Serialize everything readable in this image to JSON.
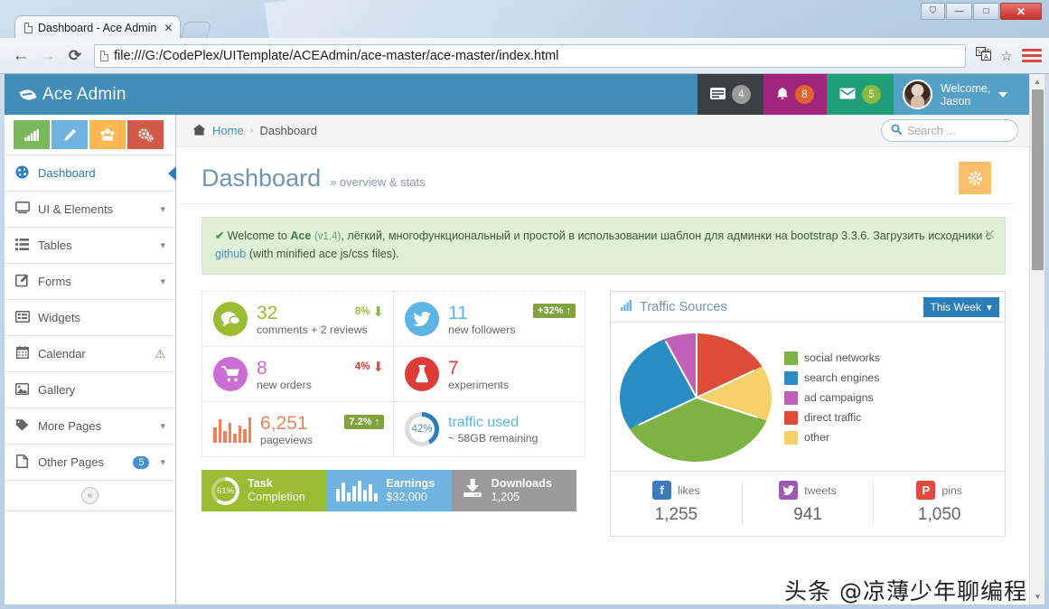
{
  "browser": {
    "tab_title": "Dashboard - Ace Admin",
    "tab_close": "✕",
    "url": "file:///G:/CodePlex/UITemplate/ACEAdmin/ace-master/ace-master/index.html",
    "back_icon": "←",
    "forward_icon": "→",
    "reload_icon": "⟳",
    "translate_icon": "translate-icon",
    "star_icon": "☆",
    "menu_icon": "hamburger-menu-icon",
    "win_user": "⛉",
    "win_minimize": "—",
    "win_maximize": "□",
    "win_close": "✕"
  },
  "navbar": {
    "brand": "Ace Admin",
    "tasks": {
      "icon": "tasks-icon",
      "count": "4"
    },
    "notifications": {
      "icon": "bell-icon",
      "count": "8"
    },
    "messages": {
      "icon": "envelope-icon",
      "count": "5"
    },
    "user": {
      "greeting": "Welcome,",
      "name": "Jason",
      "caret": "caret-down-icon"
    }
  },
  "sidebar": {
    "shortcuts": [
      {
        "name": "signal-icon",
        "glyph": "ᵚıı"
      },
      {
        "name": "pencil-icon",
        "glyph": "✎"
      },
      {
        "name": "users-icon",
        "glyph": "♟"
      },
      {
        "name": "cogs-icon",
        "glyph": "⚙"
      }
    ],
    "items": [
      {
        "label": "Dashboard",
        "icon": "dashboard-icon",
        "active": true,
        "chevron": false
      },
      {
        "label": "UI & Elements",
        "icon": "desktop-icon",
        "active": false,
        "chevron": true
      },
      {
        "label": "Tables",
        "icon": "list-icon",
        "active": false,
        "chevron": true
      },
      {
        "label": "Forms",
        "icon": "edit-icon",
        "active": false,
        "chevron": true
      },
      {
        "label": "Widgets",
        "icon": "widgets-icon",
        "active": false,
        "chevron": false
      },
      {
        "label": "Calendar",
        "icon": "calendar-icon",
        "active": false,
        "chevron": false,
        "warning": "⚠"
      },
      {
        "label": "Gallery",
        "icon": "image-icon",
        "active": false,
        "chevron": false
      },
      {
        "label": "More Pages",
        "icon": "tag-icon",
        "active": false,
        "chevron": true
      },
      {
        "label": "Other Pages",
        "icon": "file-icon",
        "active": false,
        "chevron": true,
        "badge": "5"
      }
    ],
    "collapse": "«"
  },
  "breadcrumb": {
    "home_icon": "home-icon",
    "home": "Home",
    "separator": "›",
    "current": "Dashboard"
  },
  "search": {
    "icon": "search-icon",
    "placeholder": "Search ...",
    "value": ""
  },
  "page": {
    "title": "Dashboard",
    "subtitle": "» overview & stats",
    "settings_icon": "gear-icon"
  },
  "alert": {
    "check": "✔",
    "lead": "Welcome to",
    "brand": "Ace",
    "version": "(v1.4)",
    "body1": ", лёгкий, многофункциональный и простой в использовании шаблон для админки на bootstrap 3.3.6. Загрузить исходники с ",
    "link": "github",
    "body2": " (with minified ace js/css files).",
    "close": "✕"
  },
  "infoboxes": [
    {
      "icon": "comments-icon",
      "glyph": "●●",
      "color": "green",
      "number": "32",
      "label": "comments + 2 reviews",
      "pct": "8%",
      "pct_style": "plain",
      "trend": "up"
    },
    {
      "icon": "twitter-icon",
      "glyph": "t",
      "color": "blue",
      "number": "11",
      "label": "new followers",
      "pct": "+32%",
      "pct_style": "badge",
      "trend": "up"
    },
    {
      "icon": "shopping-cart-icon",
      "glyph": "▭",
      "color": "purple",
      "number": "8",
      "label": "new orders",
      "pct": "4%",
      "pct_style": "plain",
      "trend": "down"
    },
    {
      "icon": "flask-icon",
      "glyph": "⚗",
      "color": "red",
      "number": "7",
      "label": "experiments",
      "pct": "",
      "pct_style": "none",
      "trend": ""
    },
    {
      "icon": "bar-chart-icon",
      "glyph": "sparkline",
      "color": "orange",
      "number": "6,251",
      "label": "pageviews",
      "pct": "7.2%",
      "pct_style": "badge",
      "trend": "up"
    },
    {
      "icon": "donut-icon",
      "glyph": "42%",
      "color": "blue",
      "number": "traffic used",
      "label": "~ 58GB remaining",
      "pct": "",
      "pct_style": "none",
      "trend": ""
    }
  ],
  "big_buttons": [
    {
      "icon": "task-ring-icon",
      "percent": "61%",
      "title": "Task",
      "sub": "Completion",
      "color": "green"
    },
    {
      "icon": "earnings-chart-icon",
      "title": "Earnings",
      "sub": "$32,000",
      "color": "blue"
    },
    {
      "icon": "download-icon",
      "glyph": "⬇",
      "title": "Downloads",
      "sub": "1,205",
      "color": "grey"
    }
  ],
  "widget": {
    "icon": "bar-chart-icon",
    "title": "Traffic Sources",
    "period_button": {
      "label": "This Week",
      "caret": "⌄"
    }
  },
  "chart_data": {
    "type": "pie",
    "title": "Traffic Sources",
    "labels": [
      "social networks",
      "search engines",
      "ad campaigns",
      "direct traffic",
      "other"
    ],
    "values": [
      38,
      24,
      8,
      18,
      12
    ],
    "colors": [
      "#7cb342",
      "#2b8cc4",
      "#c061b8",
      "#dd4b39",
      "#f6d06b"
    ],
    "unit": "percent",
    "legend": "right"
  },
  "social": [
    {
      "network": "facebook-icon",
      "glyph": "f",
      "label": "likes",
      "value": "1,255"
    },
    {
      "network": "twitter-icon",
      "glyph": "t",
      "label": "tweets",
      "value": "941"
    },
    {
      "network": "pinterest-icon",
      "glyph": "P",
      "label": "pins",
      "value": "1,050"
    }
  ],
  "watermark": "头条 @凉薄少年聊编程"
}
